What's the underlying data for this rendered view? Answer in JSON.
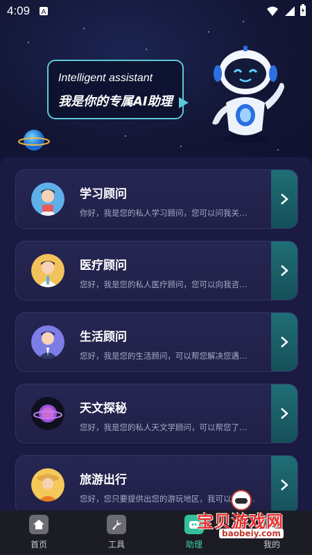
{
  "status_bar": {
    "time": "4:09"
  },
  "hero": {
    "bubble_en": "Intelligent assistant",
    "bubble_cn": "我是你的专属AI助理"
  },
  "cards": [
    {
      "title": "学习顾问",
      "desc": "你好，我是您的私人学习顾问，您可以问我关…",
      "avatar": "student-avatar",
      "color": "#5fb0e8"
    },
    {
      "title": "医疗顾问",
      "desc": "您好，我是您的私人医疗顾问，您可以向我咨…",
      "avatar": "doctor-avatar",
      "color": "#f2c35a"
    },
    {
      "title": "生活顾问",
      "desc": "您好，我是您的生活顾问，可以帮您解决您遇…",
      "avatar": "businessman-avatar",
      "color": "#7d7de8"
    },
    {
      "title": "天文探秘",
      "desc": "您好，我是您的私人天文学顾问，可以帮您了…",
      "avatar": "planet-avatar",
      "color": "#0f0f1e"
    },
    {
      "title": "旅游出行",
      "desc": "您好，您只要提供出您的游玩地区，我可以为您…",
      "avatar": "traveler-avatar",
      "color": "#f5c85a"
    }
  ],
  "tabbar": {
    "items": [
      {
        "label": "首页",
        "icon": "home-icon"
      },
      {
        "label": "工具",
        "icon": "wrench-icon"
      },
      {
        "label": "助理",
        "icon": "assistant-icon",
        "active": true
      },
      {
        "label": "我的",
        "icon": "user-icon"
      }
    ]
  },
  "watermark": {
    "title": "宝贝游戏网",
    "url": "baobeiy.com"
  },
  "colors": {
    "accent": "#3fd0a7",
    "bubble_border": "#5cc9d6",
    "arrow_bg": "#1f6e76"
  }
}
